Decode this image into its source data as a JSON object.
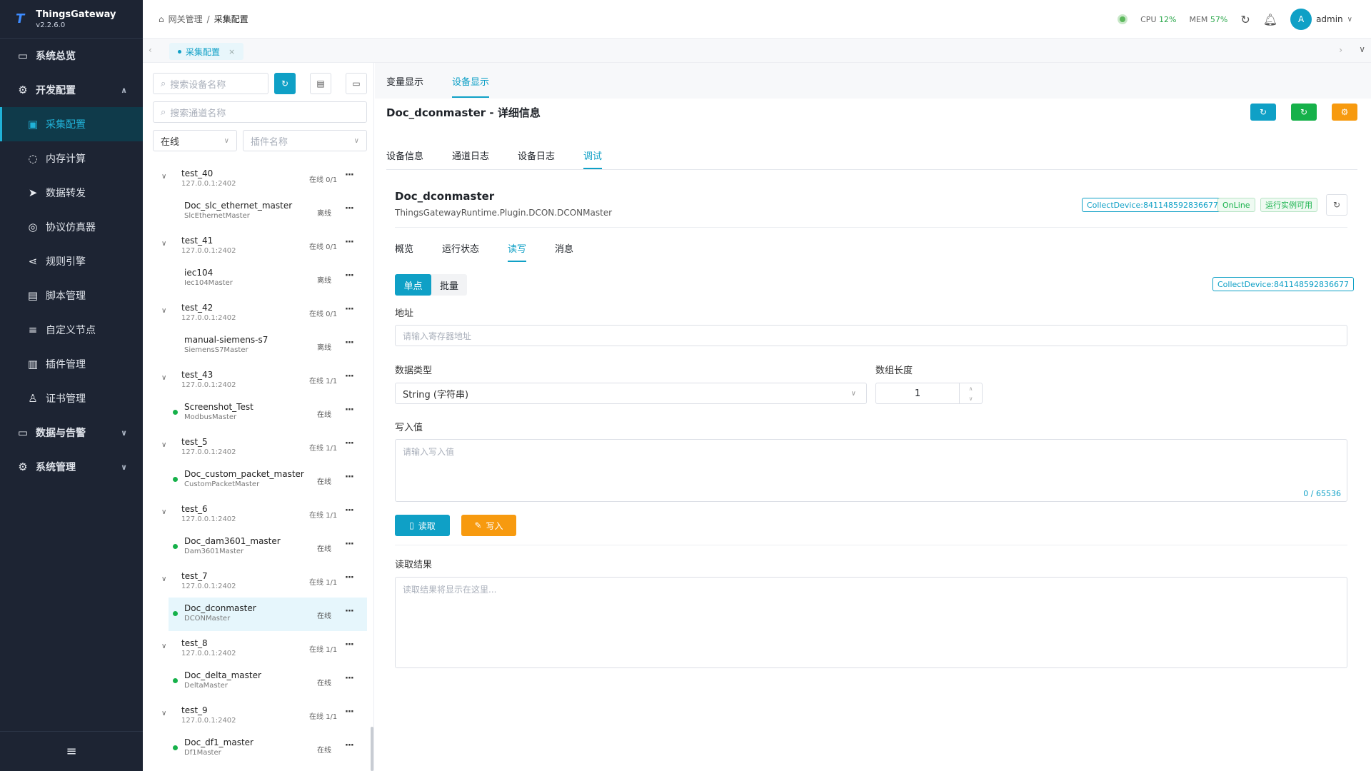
{
  "app": {
    "name": "ThingsGateway",
    "version": "v2.2.6.0",
    "logo_glyph": "T"
  },
  "sidebar": {
    "items": [
      {
        "label": "系统总览",
        "icon": "monitor-icon",
        "glyph": "▭",
        "level": "top",
        "arrow": ""
      },
      {
        "label": "开发配置",
        "icon": "gear-icon",
        "glyph": "⚙",
        "level": "top",
        "arrow": "∧"
      },
      {
        "label": "采集配置",
        "icon": "dashboard-icon",
        "glyph": "▣",
        "level": "sub",
        "arrow": ""
      },
      {
        "label": "内存计算",
        "icon": "chip-icon",
        "glyph": "◌",
        "level": "sub",
        "arrow": ""
      },
      {
        "label": "数据转发",
        "icon": "send-icon",
        "glyph": "➤",
        "level": "sub",
        "arrow": ""
      },
      {
        "label": "协议仿真器",
        "icon": "emulator-icon",
        "glyph": "◎",
        "level": "sub",
        "arrow": ""
      },
      {
        "label": "规则引擎",
        "icon": "share-icon",
        "glyph": "⋖",
        "level": "sub",
        "arrow": ""
      },
      {
        "label": "脚本管理",
        "icon": "file-icon",
        "glyph": "▤",
        "level": "sub",
        "arrow": ""
      },
      {
        "label": "自定义节点",
        "icon": "sliders-icon",
        "glyph": "≡",
        "level": "sub",
        "arrow": ""
      },
      {
        "label": "插件管理",
        "icon": "package-icon",
        "glyph": "▥",
        "level": "sub",
        "arrow": ""
      },
      {
        "label": "证书管理",
        "icon": "certificate-icon",
        "glyph": "♙",
        "level": "sub",
        "arrow": ""
      },
      {
        "label": "数据与告警",
        "icon": "chart-icon",
        "glyph": "▭",
        "level": "top",
        "arrow": "∨"
      },
      {
        "label": "系统管理",
        "icon": "settings-icon",
        "glyph": "⚙",
        "level": "top",
        "arrow": "∨"
      }
    ],
    "collapse_glyph": "≡"
  },
  "header": {
    "breadcrumb_home": "网关管理",
    "breadcrumb_sep": "/",
    "breadcrumb_current": "采集配置",
    "cpu_label": "CPU",
    "cpu_value": "12%",
    "mem_label": "MEM",
    "mem_value": "57%",
    "user_initial": "A",
    "user_name": "admin"
  },
  "tabbar": {
    "tab": "采集配置",
    "close": "×"
  },
  "left": {
    "search_device_placeholder": "搜索设备名称",
    "search_channel_placeholder": "搜索通道名称",
    "status_select": "在线",
    "plugin_select_placeholder": "插件名称",
    "groups": [
      {
        "name": "test_40",
        "ip": "127.0.0.1:2402",
        "status": "在线 0/1",
        "device": {
          "name": "Doc_slc_ethernet_master",
          "plugin": "SlcEthernetMaster",
          "status": "离线",
          "online": false
        }
      },
      {
        "name": "test_41",
        "ip": "127.0.0.1:2402",
        "status": "在线 0/1",
        "device": {
          "name": "iec104",
          "plugin": "Iec104Master",
          "status": "离线",
          "online": false
        }
      },
      {
        "name": "test_42",
        "ip": "127.0.0.1:2402",
        "status": "在线 0/1",
        "device": {
          "name": "manual-siemens-s7",
          "plugin": "SiemensS7Master",
          "status": "离线",
          "online": false
        }
      },
      {
        "name": "test_43",
        "ip": "127.0.0.1:2402",
        "status": "在线 1/1",
        "device": {
          "name": "Screenshot_Test",
          "plugin": "ModbusMaster",
          "status": "在线",
          "online": true
        }
      },
      {
        "name": "test_5",
        "ip": "127.0.0.1:2402",
        "status": "在线 1/1",
        "device": {
          "name": "Doc_custom_packet_master",
          "plugin": "CustomPacketMaster",
          "status": "在线",
          "online": true
        }
      },
      {
        "name": "test_6",
        "ip": "127.0.0.1:2402",
        "status": "在线 1/1",
        "device": {
          "name": "Doc_dam3601_master",
          "plugin": "Dam3601Master",
          "status": "在线",
          "online": true
        }
      },
      {
        "name": "test_7",
        "ip": "127.0.0.1:2402",
        "status": "在线 1/1",
        "device": {
          "name": "Doc_dconmaster",
          "plugin": "DCONMaster",
          "status": "在线",
          "online": true,
          "selected": true
        }
      },
      {
        "name": "test_8",
        "ip": "127.0.0.1:2402",
        "status": "在线 1/1",
        "device": {
          "name": "Doc_delta_master",
          "plugin": "DeltaMaster",
          "status": "在线",
          "online": true
        }
      },
      {
        "name": "test_9",
        "ip": "127.0.0.1:2402",
        "status": "在线 1/1",
        "device": {
          "name": "Doc_df1_master",
          "plugin": "Df1Master",
          "status": "在线",
          "online": true
        }
      }
    ]
  },
  "main": {
    "view_tabs": [
      "变量显示",
      "设备显示"
    ],
    "title": "Doc_dconmaster - 详细信息",
    "detail_tabs": [
      "设备信息",
      "通道日志",
      "设备日志",
      "调试"
    ],
    "device_name": "Doc_dconmaster",
    "device_plugin": "ThingsGatewayRuntime.Plugin.DCON.DCONMaster",
    "badge_device": "CollectDevice:841148592836677",
    "badge_online": "OnLine",
    "badge_runtime": "运行实例可用",
    "rw_tabs": [
      "概览",
      "运行状态",
      "读写",
      "消息"
    ],
    "mode_single": "单点",
    "mode_batch": "批量",
    "address_label": "地址",
    "address_placeholder": "请输入寄存器地址",
    "datatype_label": "数据类型",
    "datatype_value": "String (字符串)",
    "arraylen_label": "数组长度",
    "arraylen_value": "1",
    "write_label": "写入值",
    "write_placeholder": "请输入写入值",
    "write_count": "0 / 65536",
    "read_button": "读取",
    "write_button": "写入",
    "result_label": "读取结果",
    "result_placeholder": "读取结果将显示在这里..."
  },
  "colors": {
    "accent": "#0fa0c6",
    "green": "#16b14a",
    "orange": "#f79a0f",
    "sidebar_bg": "#1d2433"
  }
}
